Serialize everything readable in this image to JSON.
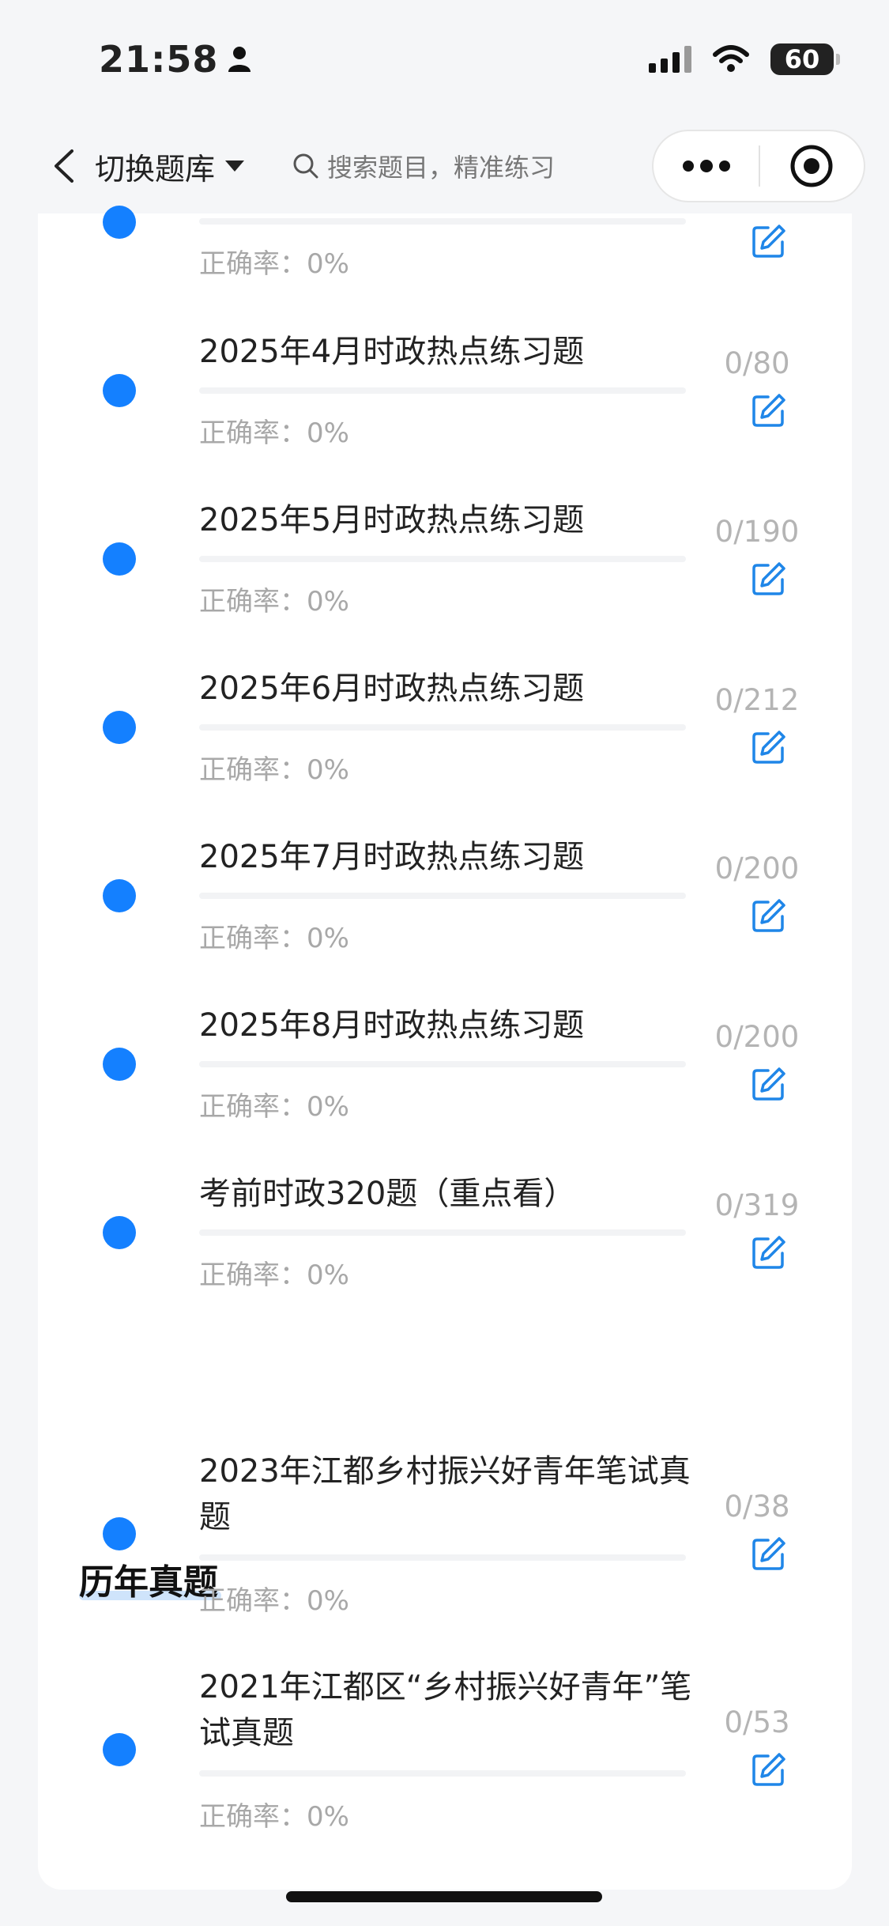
{
  "status_bar": {
    "time": "21:58",
    "battery": "60"
  },
  "nav": {
    "switch_label": "切换题库",
    "search_placeholder": "搜索题目，精准练习"
  },
  "items": [
    {
      "title": "",
      "accuracy": "正确率：0%",
      "count": ""
    },
    {
      "title": "2025年4月时政热点练习题",
      "accuracy": "正确率：0%",
      "count": "0/80"
    },
    {
      "title": "2025年5月时政热点练习题",
      "accuracy": "正确率：0%",
      "count": "0/190"
    },
    {
      "title": "2025年6月时政热点练习题",
      "accuracy": "正确率：0%",
      "count": "0/212"
    },
    {
      "title": "2025年7月时政热点练习题",
      "accuracy": "正确率：0%",
      "count": "0/200"
    },
    {
      "title": "2025年8月时政热点练习题",
      "accuracy": "正确率：0%",
      "count": "0/200"
    },
    {
      "title": "考前时政320题（重点看）",
      "accuracy": "正确率：0%",
      "count": "0/319"
    }
  ],
  "section": {
    "title": "历年真题"
  },
  "past_items": [
    {
      "title": "2023年江都乡村振兴好青年笔试真题",
      "accuracy": "正确率：0%",
      "count": "0/38"
    },
    {
      "title": "2021年江都区“乡村振兴好青年”笔试真题",
      "accuracy": "正确率：0%",
      "count": "0/53"
    }
  ]
}
